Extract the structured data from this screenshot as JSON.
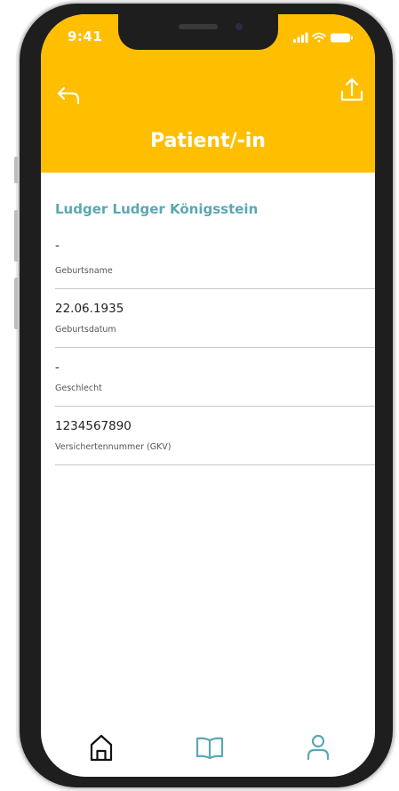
{
  "status_bar": {
    "time": "9:41"
  },
  "header": {
    "title": "Patient/-in",
    "back_icon": "back-arrow-icon",
    "share_icon": "share-upload-icon",
    "background_color": "#ffbf00"
  },
  "patient": {
    "name": "Ludger Ludger Königsstein",
    "name_color": "#5aa8b4"
  },
  "fields": [
    {
      "value": "-",
      "label": "Geburtsname"
    },
    {
      "value": "22.06.1935",
      "label": "Geburtsdatum"
    },
    {
      "value": "-",
      "label": "Geschlecht"
    },
    {
      "value": "1234567890",
      "label": "Versichertennummer (GKV)"
    }
  ],
  "bottom_nav": {
    "items": [
      {
        "icon": "home-icon",
        "color": "#111111"
      },
      {
        "icon": "book-icon",
        "color": "#5aa8b4"
      },
      {
        "icon": "profile-icon",
        "color": "#5aa8b4"
      }
    ]
  }
}
